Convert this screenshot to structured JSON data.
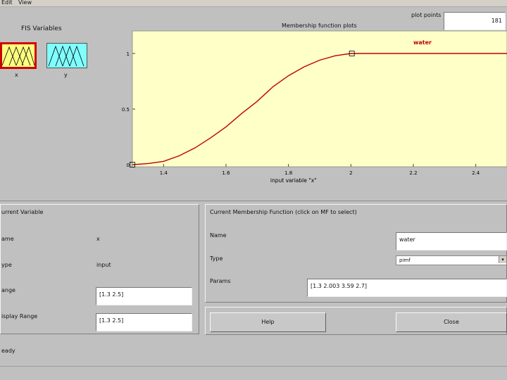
{
  "menu": [
    "Edit",
    "View"
  ],
  "fis_variables": {
    "title": "FIS Variables",
    "inputs": [
      {
        "label": "x",
        "color": "#ffff80",
        "selected": true
      }
    ],
    "outputs": [
      {
        "label": "y",
        "color": "#80ffff",
        "selected": false
      }
    ]
  },
  "plot": {
    "title": "Membership function plots",
    "plot_points_label": "plot points",
    "plot_points_value": "181"
  },
  "chart_data": {
    "type": "line",
    "title": "Membership function plots",
    "xlabel": "input variable \"x\"",
    "ylabel": "",
    "xlim": [
      1.3,
      2.5
    ],
    "ylim": [
      0,
      1
    ],
    "x_ticks": [
      "1.4",
      "1.6",
      "1.8",
      "2",
      "2.2",
      "2.4"
    ],
    "y_ticks": [
      "0",
      "0.5",
      "1"
    ],
    "series": [
      {
        "name": "water",
        "color": "#c00000",
        "mf_type": "pimf",
        "params": [
          1.3,
          2.003,
          3.59,
          2.7
        ],
        "x": [
          1.3,
          1.35,
          1.4,
          1.45,
          1.5,
          1.55,
          1.6,
          1.65,
          1.7,
          1.75,
          1.8,
          1.85,
          1.9,
          1.95,
          2.0,
          2.003,
          2.1,
          2.2,
          2.3,
          2.4,
          2.5
        ],
        "y": [
          0.0,
          0.01,
          0.03,
          0.08,
          0.15,
          0.24,
          0.34,
          0.46,
          0.57,
          0.7,
          0.8,
          0.88,
          0.94,
          0.98,
          1.0,
          1.0,
          1.0,
          1.0,
          1.0,
          1.0,
          1.0
        ]
      }
    ],
    "markers": [
      {
        "x": 1.3,
        "y": 0
      },
      {
        "x": 2.003,
        "y": 1
      }
    ],
    "grid": false
  },
  "current_variable": {
    "title": "urrent Variable",
    "name_label": "ame",
    "name_value": "x",
    "type_label": "ype",
    "type_value": "input",
    "range_label": "ange",
    "range_value": "[1.3 2.5]",
    "display_range_label": "isplay Range",
    "display_range_value": "[1.3 2.5]"
  },
  "current_mf": {
    "title": "Current Membership Function (click on MF to select)",
    "name_label": "Name",
    "name_value": "water",
    "type_label": "Type",
    "type_value": "pimf",
    "params_label": "Params",
    "params_value": "[1.3 2.003 3.59 2.7]"
  },
  "buttons": {
    "help": "Help",
    "close": "Close"
  },
  "status": "eady"
}
